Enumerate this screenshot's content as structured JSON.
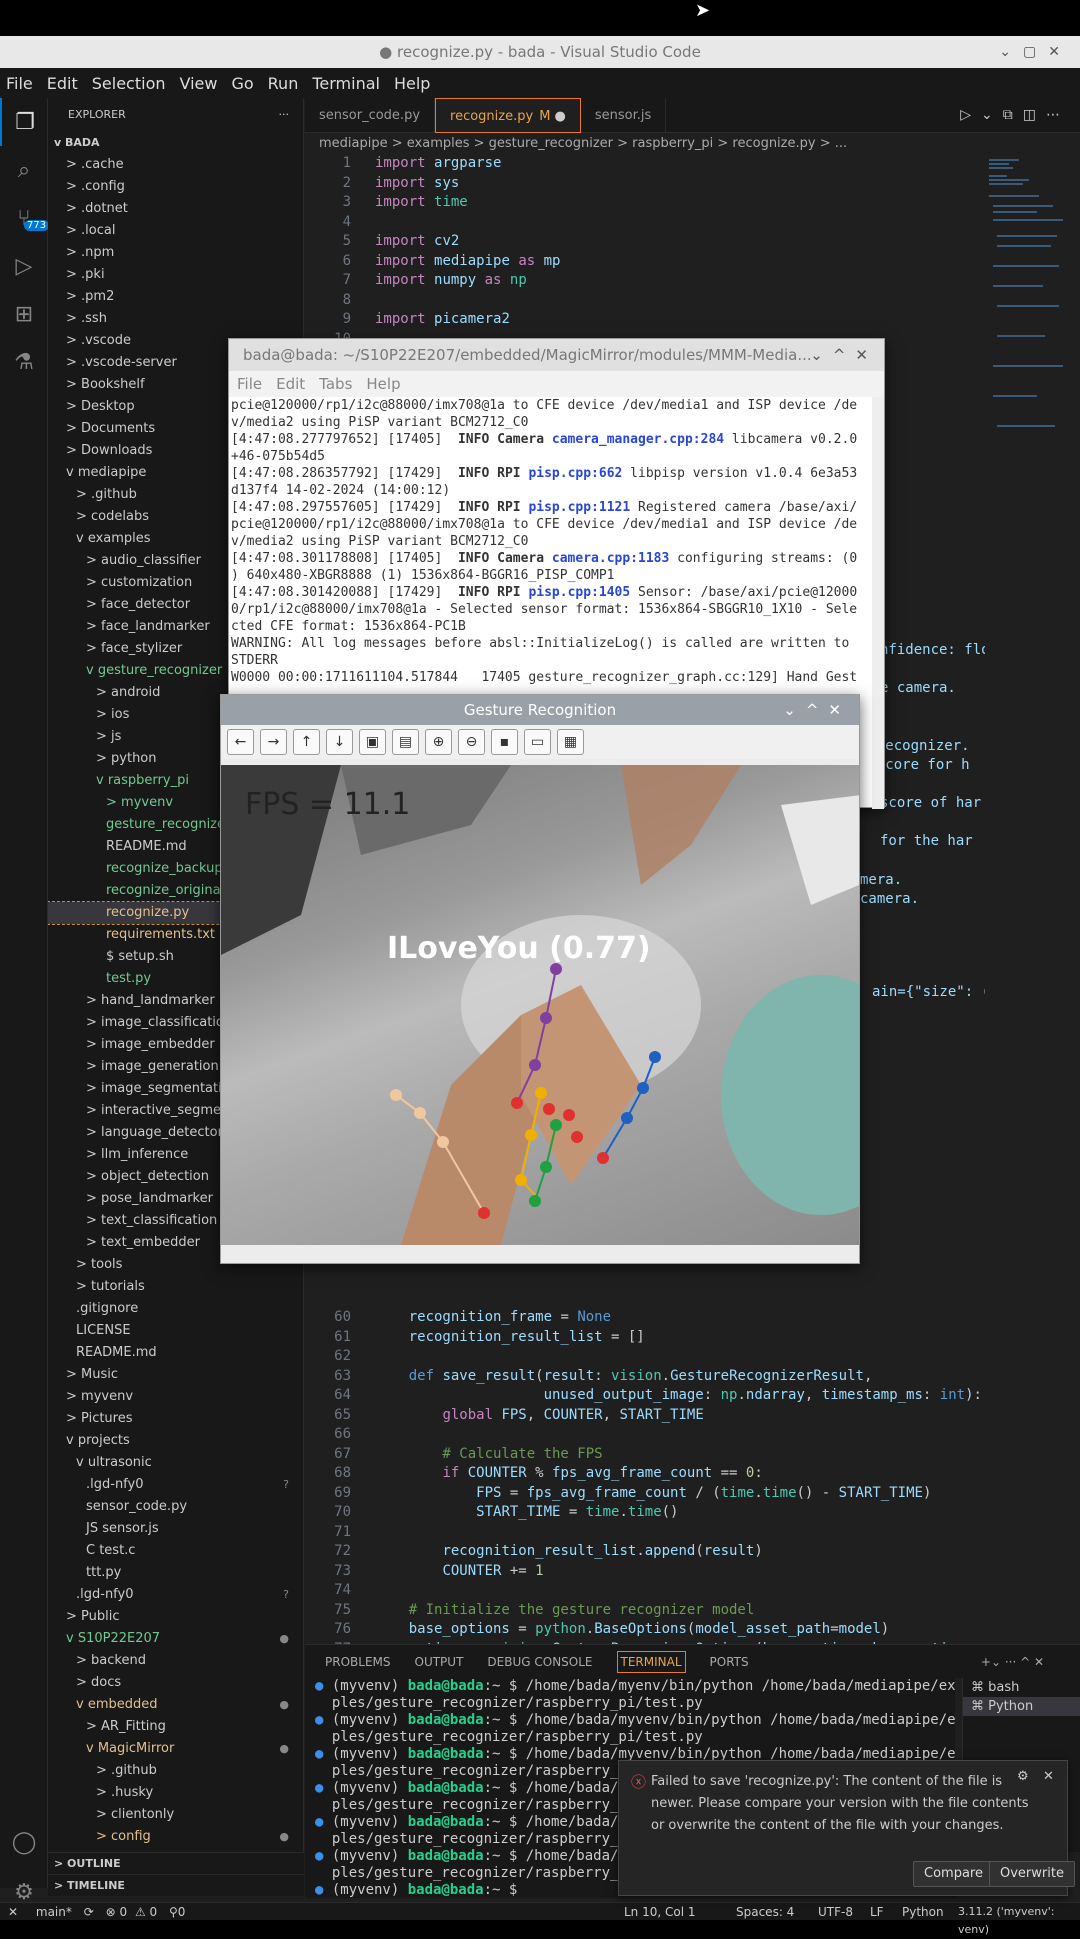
{
  "window": {
    "title": "● recognize.py - bada - Visual Studio Code"
  },
  "menu": [
    "File",
    "Edit",
    "Selection",
    "View",
    "Go",
    "Run",
    "Terminal",
    "Help"
  ],
  "activity": {
    "scm_badge": "773"
  },
  "explorer": {
    "header": "EXPLORER",
    "root": "BADA",
    "outline": "OUTLINE",
    "timeline": "TIMELINE",
    "items": [
      {
        "label": "> .cache",
        "indent": 1
      },
      {
        "label": "> .config",
        "indent": 1
      },
      {
        "label": "> .dotnet",
        "indent": 1
      },
      {
        "label": "> .local",
        "indent": 1
      },
      {
        "label": "> .npm",
        "indent": 1
      },
      {
        "label": "> .pki",
        "indent": 1
      },
      {
        "label": "> .pm2",
        "indent": 1
      },
      {
        "label": "> .ssh",
        "indent": 1
      },
      {
        "label": "> .vscode",
        "indent": 1
      },
      {
        "label": "> .vscode-server",
        "indent": 1
      },
      {
        "label": "> Bookshelf",
        "indent": 1
      },
      {
        "label": "> Desktop",
        "indent": 1
      },
      {
        "label": "> Documents",
        "indent": 1
      },
      {
        "label": "> Downloads",
        "indent": 1
      },
      {
        "label": "v mediapipe",
        "indent": 1
      },
      {
        "label": "> .github",
        "indent": 2
      },
      {
        "label": "> codelabs",
        "indent": 2
      },
      {
        "label": "v examples",
        "indent": 2
      },
      {
        "label": "> audio_classifier",
        "indent": 3
      },
      {
        "label": "> customization",
        "indent": 3
      },
      {
        "label": "> face_detector",
        "indent": 3
      },
      {
        "label": "> face_landmarker",
        "indent": 3
      },
      {
        "label": "> face_stylizer",
        "indent": 3
      },
      {
        "label": "v gesture_recognizer",
        "indent": 3,
        "color": "#73c991"
      },
      {
        "label": "> android",
        "indent": 4
      },
      {
        "label": "> ios",
        "indent": 4
      },
      {
        "label": "> js",
        "indent": 4
      },
      {
        "label": "> python",
        "indent": 4
      },
      {
        "label": "v raspberry_pi",
        "indent": 4,
        "color": "#73c991"
      },
      {
        "label": "> myvenv",
        "indent": 5,
        "color": "#73c991"
      },
      {
        "label": "gesture_recognizer...",
        "indent": 5,
        "color": "#73c991"
      },
      {
        "label": "README.md",
        "indent": 5
      },
      {
        "label": "recognize_backup...",
        "indent": 5,
        "color": "#73c991"
      },
      {
        "label": "recognize_original...",
        "indent": 5,
        "color": "#73c991"
      },
      {
        "label": "recognize.py",
        "indent": 5,
        "color": "#e2c08d",
        "selected": true
      },
      {
        "label": "requirements.txt",
        "indent": 5,
        "color": "#e2c08d"
      },
      {
        "label": "$ setup.sh",
        "indent": 5
      },
      {
        "label": "test.py",
        "indent": 5,
        "color": "#73c991"
      },
      {
        "label": "> hand_landmarker",
        "indent": 3
      },
      {
        "label": "> image_classification",
        "indent": 3
      },
      {
        "label": "> image_embedder",
        "indent": 3
      },
      {
        "label": "> image_generation",
        "indent": 3
      },
      {
        "label": "> image_segmentation",
        "indent": 3
      },
      {
        "label": "> interactive_segmenta...",
        "indent": 3
      },
      {
        "label": "> language_detector",
        "indent": 3
      },
      {
        "label": "> llm_inference",
        "indent": 3
      },
      {
        "label": "> object_detection",
        "indent": 3
      },
      {
        "label": "> pose_landmarker",
        "indent": 3
      },
      {
        "label": "> text_classification",
        "indent": 3
      },
      {
        "label": "> text_embedder",
        "indent": 3
      },
      {
        "label": "> tools",
        "indent": 2
      },
      {
        "label": "> tutorials",
        "indent": 2
      },
      {
        "label": ".gitignore",
        "indent": 2
      },
      {
        "label": "LICENSE",
        "indent": 2
      },
      {
        "label": "README.md",
        "indent": 2
      },
      {
        "label": "> Music",
        "indent": 1
      },
      {
        "label": "> myvenv",
        "indent": 1
      },
      {
        "label": "> Pictures",
        "indent": 1
      },
      {
        "label": "v projects",
        "indent": 1
      },
      {
        "label": "v ultrasonic",
        "indent": 2
      },
      {
        "label": ".lgd-nfy0",
        "indent": 3,
        "mark": "?"
      },
      {
        "label": "sensor_code.py",
        "indent": 3
      },
      {
        "label": "JS sensor.js",
        "indent": 3
      },
      {
        "label": "C test.c",
        "indent": 3
      },
      {
        "label": "ttt.py",
        "indent": 3
      },
      {
        "label": ".lgd-nfy0",
        "indent": 2,
        "mark": "?"
      },
      {
        "label": "> Public",
        "indent": 1
      },
      {
        "label": "v S10P22E207",
        "indent": 1,
        "color": "#73c991",
        "mark": "●"
      },
      {
        "label": "> backend",
        "indent": 2
      },
      {
        "label": "> docs",
        "indent": 2
      },
      {
        "label": "v embedded",
        "indent": 2,
        "color": "#e2c08d",
        "mark": "●"
      },
      {
        "label": "> AR_Fitting",
        "indent": 3
      },
      {
        "label": "v MagicMirror",
        "indent": 3,
        "color": "#e2c08d",
        "mark": "●"
      },
      {
        "label": "> .github",
        "indent": 4
      },
      {
        "label": "> .husky",
        "indent": 4
      },
      {
        "label": "> clientonly",
        "indent": 4
      },
      {
        "label": "> config",
        "indent": 4,
        "color": "#e2c08d",
        "mark": "●"
      }
    ]
  },
  "tabs": [
    {
      "label": "sensor_code.py"
    },
    {
      "label": "recognize.py",
      "badge": "M"
    },
    {
      "label": "sensor.js"
    }
  ],
  "breadcrumb": "mediapipe  >  examples  >  gesture_recognizer  >  raspberry_pi  >  recognize.py  >  ...",
  "code_top": [
    {
      "n": "1",
      "t": "import argparse"
    },
    {
      "n": "2",
      "t": "import sys"
    },
    {
      "n": "3",
      "t": "import time"
    },
    {
      "n": "4",
      "t": ""
    },
    {
      "n": "5",
      "t": "import cv2"
    },
    {
      "n": "6",
      "t": "import mediapipe as mp"
    },
    {
      "n": "7",
      "t": "import numpy as np"
    },
    {
      "n": "8",
      "t": ""
    },
    {
      "n": "9",
      "t": "import picamera2"
    },
    {
      "n": "10",
      "t": ""
    }
  ],
  "code_bottom": [
    {
      "n": "60",
      "t": "    recognition_frame = None"
    },
    {
      "n": "61",
      "t": "    recognition_result_list = []"
    },
    {
      "n": "62",
      "t": ""
    },
    {
      "n": "63",
      "t": "    def save_result(result: vision.GestureRecognizerResult,"
    },
    {
      "n": "64",
      "t": "                    unused_output_image: np.ndarray, timestamp_ms: int):"
    },
    {
      "n": "65",
      "t": "        global FPS, COUNTER, START_TIME"
    },
    {
      "n": "66",
      "t": ""
    },
    {
      "n": "67",
      "t": "        # Calculate the FPS"
    },
    {
      "n": "68",
      "t": "        if COUNTER % fps_avg_frame_count == 0:"
    },
    {
      "n": "69",
      "t": "            FPS = fps_avg_frame_count / (time.time() - START_TIME)"
    },
    {
      "n": "70",
      "t": "            START_TIME = time.time()"
    },
    {
      "n": "71",
      "t": ""
    },
    {
      "n": "72",
      "t": "        recognition_result_list.append(result)"
    },
    {
      "n": "73",
      "t": "        COUNTER += 1"
    },
    {
      "n": "74",
      "t": ""
    },
    {
      "n": "75",
      "t": "    # Initialize the gesture recognizer model"
    },
    {
      "n": "76",
      "t": "    base_options = python.BaseOptions(model_asset_path=model)"
    },
    {
      "n": "77",
      "t": "    options = vision.GestureRecognizerOptions(base_options=base_options,"
    },
    {
      "n": "78",
      "t": "                                              running_mode=vision.RunningMc"
    }
  ],
  "code_frags": [
    "nfidence: flo",
    "e camera.",
    "e recognizer.",
    "e score for h",
    "score of har",
    "for the har",
    "mera.",
    "camera.",
    "ain={\"size\": (w"
  ],
  "term": {
    "title": "bada@bada: ~/S10P22E207/embedded/MagicMirror/modules/MMM-Media...",
    "menu": [
      "File",
      "Edit",
      "Tabs",
      "Help"
    ],
    "lines": [
      "pcie@120000/rp1/i2c@88000/imx708@1a to CFE device /dev/media1 and ISP device /de",
      "v/media2 using PiSP variant BCM2712_C0",
      "[4:47:08.277797652] [17405]  INFO Camera camera_manager.cpp:284 libcamera v0.2.0",
      "+46-075b54d5",
      "[4:47:08.286357792] [17429]  INFO RPI pisp.cpp:662 libpisp version v1.0.4 6e3a53",
      "d137f4 14-02-2024 (14:00:12)",
      "[4:47:08.297557605] [17429]  INFO RPI pisp.cpp:1121 Registered camera /base/axi/",
      "pcie@120000/rp1/i2c@88000/imx708@1a to CFE device /dev/media1 and ISP device /de",
      "v/media2 using PiSP variant BCM2712_C0",
      "[4:47:08.301178808] [17405]  INFO Camera camera.cpp:1183 configuring streams: (0",
      ") 640x480-XBGR8888 (1) 1536x864-BGGR16_PISP_COMP1",
      "[4:47:08.301420088] [17429]  INFO RPI pisp.cpp:1405 Sensor: /base/axi/pcie@12000",
      "0/rp1/i2c@88000/imx708@1a - Selected sensor format: 1536x864-SBGGR10_1X10 - Sele",
      "cted CFE format: 1536x864-PC1B",
      "WARNING: All log messages before absl::InitializeLog() is called are written to",
      "STDERR",
      "W0000 00:00:1711611104.517844   17405 gesture_recognizer_graph.cc:129] Hand Gest"
    ]
  },
  "gesture": {
    "title": "Gesture Recognition",
    "fps": "FPS = 11.1",
    "label": "ILoveYou (0.77)"
  },
  "panel": {
    "tabs": [
      "PROBLEMS",
      "OUTPUT",
      "DEBUG CONSOLE",
      "TERMINAL",
      "PORTS"
    ],
    "active": "TERMINAL",
    "lines": [
      {
        "p": "(myvenv) ",
        "u": "bada@bada",
        "r": ":~ $ /home/bada/myenv/bin/python /home/bada/mediapipe/exam"
      },
      {
        "p": "",
        "u": "",
        "r": "ples/gesture_recognizer/raspberry_pi/test.py"
      },
      {
        "p": "(myvenv) ",
        "u": "bada@bada",
        "r": ":~ $ /home/bada/myvenv/bin/python /home/bada/mediapipe/exam"
      },
      {
        "p": "",
        "u": "",
        "r": "ples/gesture_recognizer/raspberry_pi/test.py"
      },
      {
        "p": "(myvenv) ",
        "u": "bada@bada",
        "r": ":~ $ /home/bada/myvenv/bin/python /home/bada/mediapipe/exam"
      },
      {
        "p": "",
        "u": "",
        "r": "ples/gesture_recognizer/raspberry_pi/"
      },
      {
        "p": "(myvenv) ",
        "u": "bada@bada",
        "r": ":~ $ /home/bada/myvenv/bin/python /home/bada/mediapipe/exam"
      },
      {
        "p": "",
        "u": "",
        "r": "ples/gesture_recognizer/raspberry_pi/"
      },
      {
        "p": "(myvenv) ",
        "u": "bada@bada",
        "r": ":~ $ /home/bada/myvenv/bin/python /home/bada/mediapipe/exam"
      },
      {
        "p": "",
        "u": "",
        "r": "ples/gesture_recognizer/raspberry_pi/"
      },
      {
        "p": "(myvenv) ",
        "u": "bada@bada",
        "r": ":~ $ /home/bada/myvenv/bin/python /home/bada/mediapipe/exam"
      },
      {
        "p": "",
        "u": "",
        "r": "ples/gesture_recognizer/raspberry_pi/"
      },
      {
        "p": "(myvenv) ",
        "u": "bada@bada",
        "r": ":~ $ "
      }
    ],
    "shells": [
      "bash",
      "Python"
    ]
  },
  "notification": {
    "text": "Failed to save 'recognize.py': The content of the file is newer. Please compare your version with the file contents or overwrite the content of the file with your changes.",
    "compare": "Compare",
    "overwrite": "Overwrite"
  },
  "status": {
    "branch": "main*",
    "errors": "⊗ 0",
    "warnings": "⚠ 0",
    "ports": "0",
    "position": "Ln 10, Col 1",
    "spaces": "Spaces: 4",
    "encoding": "UTF-8",
    "eol": "LF",
    "language": "Python",
    "interpreter": "3.11.2 ('myvenv': venv)"
  }
}
